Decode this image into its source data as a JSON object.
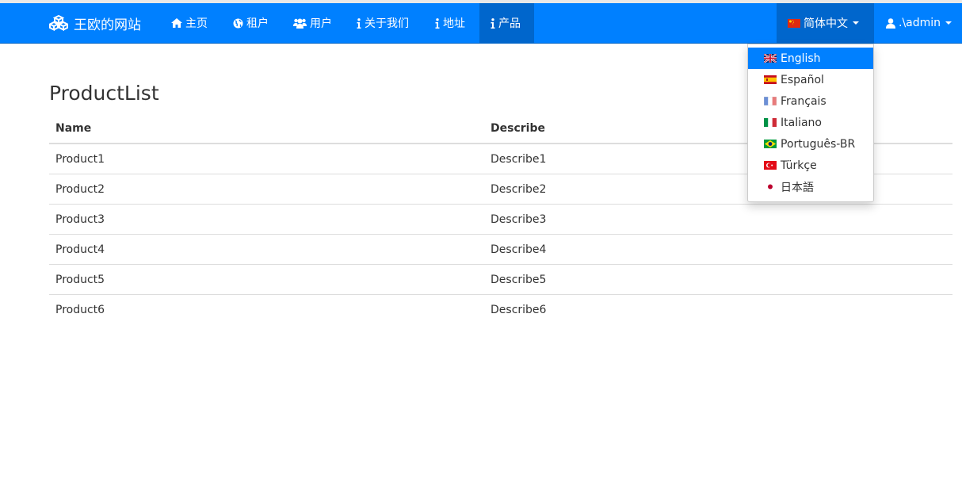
{
  "navbar": {
    "brand": "王欧的网站",
    "items": [
      {
        "label": "主页",
        "icon": "home-icon"
      },
      {
        "label": "租户",
        "icon": "globe-icon"
      },
      {
        "label": "用户",
        "icon": "users-icon"
      },
      {
        "label": "关于我们",
        "icon": "info-icon"
      },
      {
        "label": "地址",
        "icon": "info-icon"
      },
      {
        "label": "产品",
        "icon": "info-icon",
        "active": true
      }
    ],
    "language": "简体中文",
    "user": ".\\admin"
  },
  "language_menu": [
    {
      "label": "English",
      "flag": "gb-flag-icon",
      "active": true
    },
    {
      "label": "Español",
      "flag": "es-flag-icon"
    },
    {
      "label": "Français",
      "flag": "fr-flag-icon"
    },
    {
      "label": "Italiano",
      "flag": "it-flag-icon"
    },
    {
      "label": "Português-BR",
      "flag": "br-flag-icon"
    },
    {
      "label": "Türkçe",
      "flag": "tr-flag-icon"
    },
    {
      "label": "日本語",
      "flag": "jp-flag-icon"
    }
  ],
  "page": {
    "title": "ProductList"
  },
  "table": {
    "headers": [
      "Name",
      "Describe"
    ],
    "rows": [
      [
        "Product1",
        "Describe1"
      ],
      [
        "Product2",
        "Describe2"
      ],
      [
        "Product3",
        "Describe3"
      ],
      [
        "Product4",
        "Describe4"
      ],
      [
        "Product5",
        "Describe5"
      ],
      [
        "Product6",
        "Describe6"
      ]
    ]
  },
  "colors": {
    "navbar": "#0080ff",
    "navbar_active": "#0066cc",
    "menu_active": "#0080ff"
  }
}
